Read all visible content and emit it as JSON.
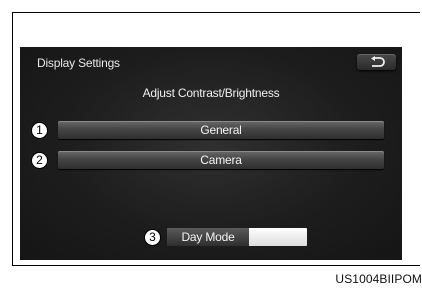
{
  "header": {
    "title": "Display Settings",
    "back_icon": "back-arrow-icon"
  },
  "subtitle": "Adjust Contrast/Brightness",
  "menu": [
    {
      "label": "General",
      "callout": "1"
    },
    {
      "label": "Camera",
      "callout": "2"
    }
  ],
  "mode_button": {
    "label": "Day Mode",
    "callout": "3"
  },
  "image_code": "US1004BIIPOM",
  "colors": {
    "screen_bg": "#1d1d1d",
    "button_gray": "#454545",
    "text": "#f0f0f0"
  }
}
